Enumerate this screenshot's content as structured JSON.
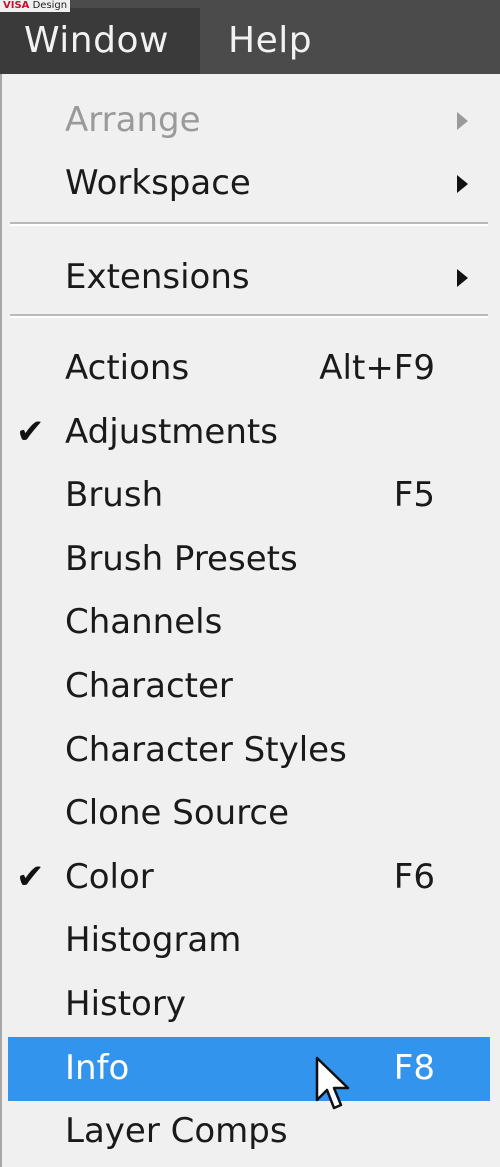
{
  "watermark": {
    "brand_red": "VISA",
    "brand_rest": " Design"
  },
  "menubar": {
    "items": [
      {
        "label": "Window"
      },
      {
        "label": "Help"
      }
    ]
  },
  "menu": {
    "items": [
      {
        "label": "Arrange",
        "submenu": true,
        "disabled": true
      },
      {
        "label": "Workspace",
        "submenu": true
      },
      {
        "label": "Extensions",
        "submenu": true
      },
      {
        "label": "Actions",
        "shortcut": "Alt+F9"
      },
      {
        "label": "Adjustments",
        "checked": true
      },
      {
        "label": "Brush",
        "shortcut": "F5"
      },
      {
        "label": "Brush Presets"
      },
      {
        "label": "Channels"
      },
      {
        "label": "Character"
      },
      {
        "label": "Character Styles"
      },
      {
        "label": "Clone Source"
      },
      {
        "label": "Color",
        "shortcut": "F6",
        "checked": true
      },
      {
        "label": "Histogram"
      },
      {
        "label": "History"
      },
      {
        "label": "Info",
        "shortcut": "F8",
        "highlighted": true
      },
      {
        "label": "Layer Comps"
      }
    ],
    "check_glyph": "✔"
  },
  "colors": {
    "menubar_bg": "#4b4b4b",
    "menu_bg": "#f0f0f0",
    "highlight": "#3294ec",
    "disabled_text": "#9a9a9a"
  },
  "icons": {
    "pointer": "mouse-pointer-icon",
    "check": "checkmark-icon",
    "submenu": "submenu-arrow-icon"
  }
}
